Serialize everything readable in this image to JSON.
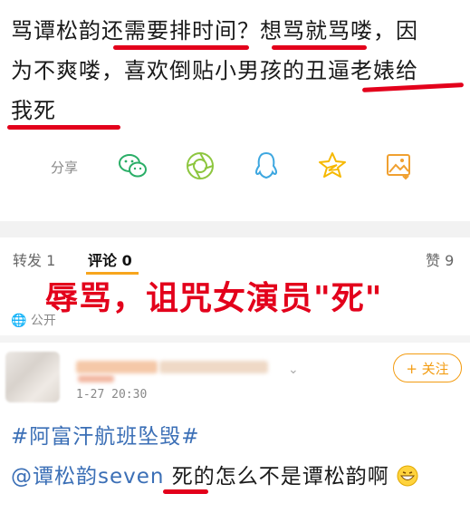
{
  "post": {
    "line1": "骂谭松韵还需要排时间？想骂就骂喽，因",
    "line2": "为不爽喽，喜欢倒贴小男孩的丑逼老婊给",
    "line3": "我死"
  },
  "share": {
    "label": "分享"
  },
  "icons": [
    "wechat-icon",
    "moments-icon",
    "qq-icon",
    "qzone-icon",
    "gallery-icon"
  ],
  "tabs": {
    "repost": "转发 1",
    "comments": "评论 0",
    "likes": "赞 9"
  },
  "caption": "辱骂，诅咒女演员\"死\"",
  "visibility": "公开",
  "comment": {
    "follow_label": "+ 关注",
    "time": "1-27 20:30",
    "topic": "#阿富汗航班坠毁#",
    "mention": "@谭松韵seven",
    "text": " 死的怎么不是谭松韵啊"
  },
  "colors": {
    "accent_red": "#e3001b",
    "link_blue": "#3b6fb6",
    "follow_orange": "#f39c12",
    "tab_indicator": "#f7a51c"
  }
}
